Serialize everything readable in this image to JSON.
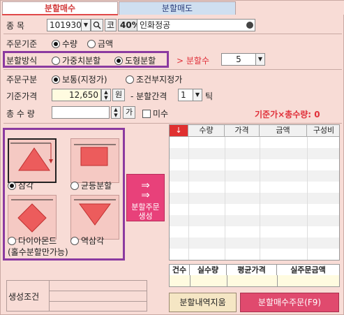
{
  "tabs": {
    "buy": "분할매수",
    "sell": "분할매도"
  },
  "stock": {
    "label": "종   목",
    "code": "101930",
    "badge": "코",
    "ratio": "40%",
    "name": "인화정공"
  },
  "order_basis": {
    "label": "주문기준",
    "opt_qty": "수량",
    "opt_amount": "금액",
    "selected": "수량"
  },
  "split_method": {
    "label": "분할방식",
    "opt_weighted": "가중치분할",
    "opt_shape": "도형분할",
    "selected": "도형분할",
    "count_label": "> 분할수",
    "count_value": "5"
  },
  "order_type": {
    "label": "주문구분",
    "opt_normal": "보통(지정가)",
    "opt_cond": "조건부지정가",
    "selected": "보통(지정가)"
  },
  "base_price": {
    "label": "기준가격",
    "value": "12,650",
    "unit": "원",
    "gap_label": "- 분할간격",
    "gap_value": "1",
    "gap_unit": "틱"
  },
  "total_qty": {
    "label": "총 수 량",
    "value": "",
    "btn": "가",
    "unfilled_label": "미수",
    "summary": "기준가×총수량: 0"
  },
  "shapes": {
    "triangle": "삼각",
    "even": "균등분할",
    "diamond": "다이아몬드",
    "diamond_note": "(홀수분할만가능)",
    "inverse": "역삼각",
    "selected": "삼각"
  },
  "generate_button": {
    "line1": "분할주문",
    "line2": "생성"
  },
  "grid": {
    "columns": [
      "↓",
      "수량",
      "가격",
      "금액",
      "구성비"
    ],
    "rows": []
  },
  "summary": {
    "columns": [
      "건수",
      "실수량",
      "평균가격",
      "실주문금액"
    ]
  },
  "condition_label": "생성조건",
  "buttons": {
    "clear": "분할내역지움",
    "order": "분할매수주문(F9)"
  },
  "colors": {
    "accent": "#e04a6e",
    "background": "#f8dcd6",
    "highlight_box": "#8b3aa0",
    "shape_fill": "#ec5c5c"
  }
}
